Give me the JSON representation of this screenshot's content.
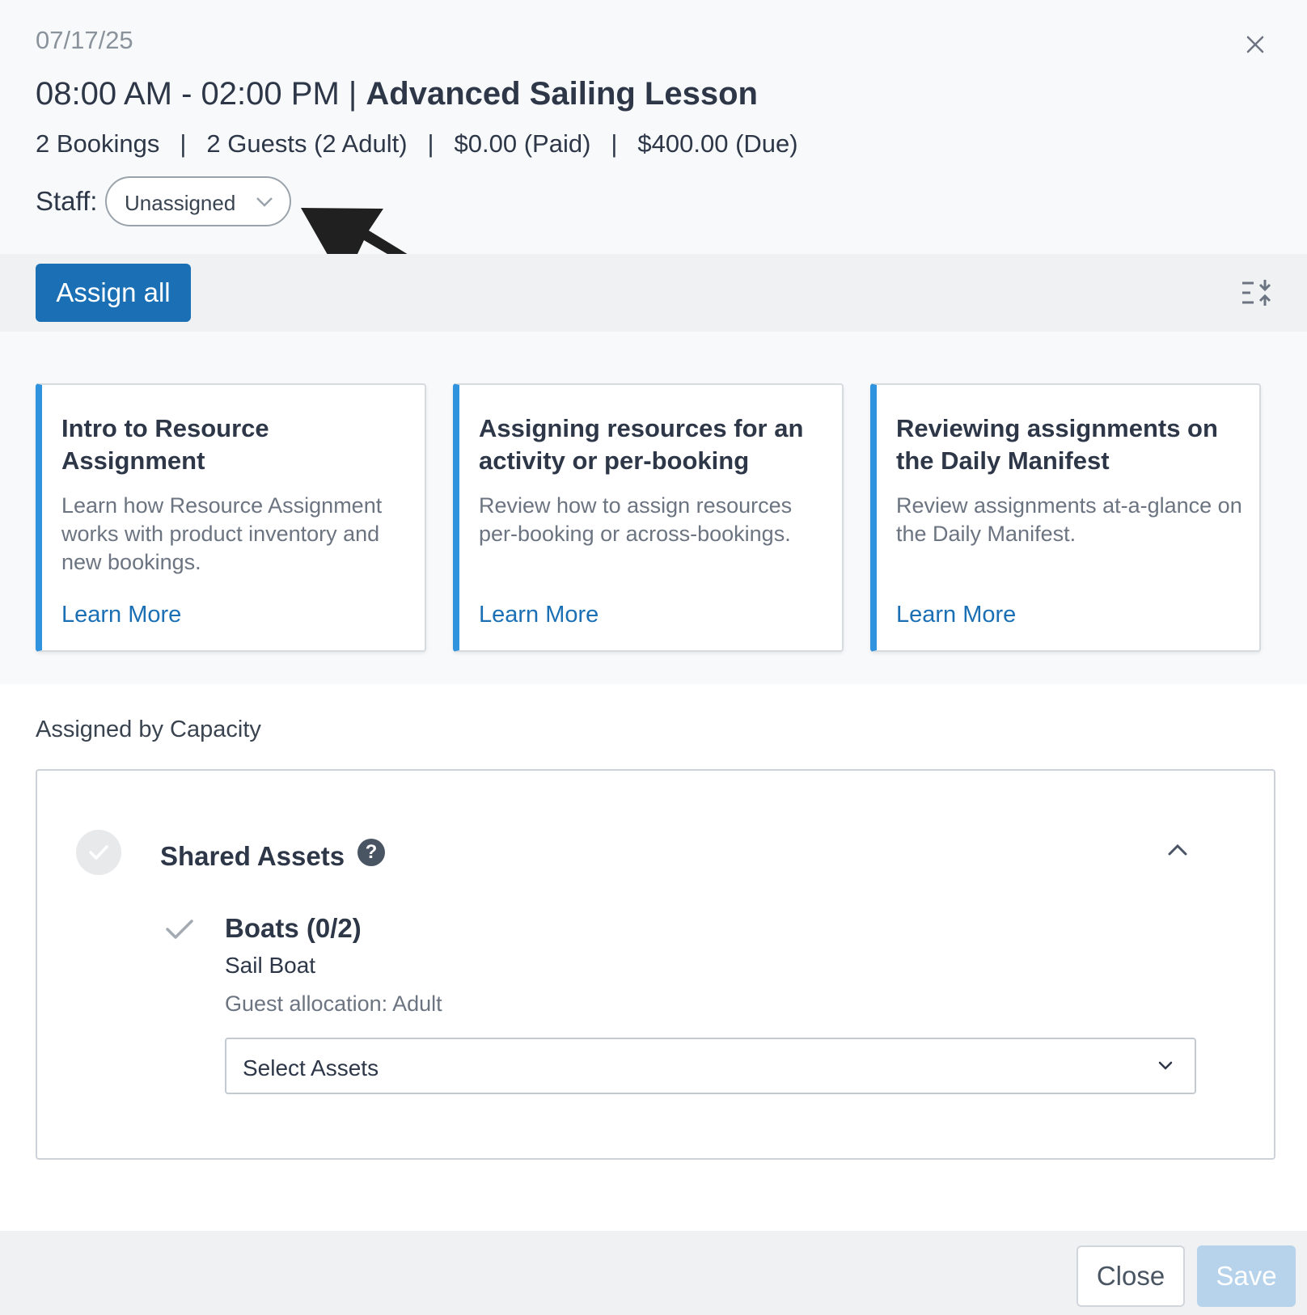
{
  "header": {
    "date": "07/17/25",
    "time_range": "08:00 AM - 02:00 PM |",
    "activity_name": "Advanced Sailing Lesson",
    "summary": {
      "bookings": "2 Bookings",
      "guests": "2 Guests (2 Adult)",
      "paid": "$0.00 (Paid)",
      "due": "$400.00 (Due)",
      "separator": "|"
    },
    "staff_label": "Staff:",
    "staff_value": "Unassigned",
    "close_icon": "close-icon"
  },
  "toolbar": {
    "assign_all_label": "Assign all",
    "collapse_icon": "collapse-all-icon"
  },
  "cards": [
    {
      "title": "Intro to Resource Assignment",
      "description": "Learn how Resource Assignment works with product inventory and new bookings.",
      "link": "Learn More"
    },
    {
      "title": "Assigning resources for an activity or per-booking",
      "description": "Review how to assign resources per-booking or across-bookings.",
      "link": "Learn More"
    },
    {
      "title": "Reviewing assignments on the Daily Manifest",
      "description": "Review assignments at-a-glance on the Daily Manifest.",
      "link": "Learn More"
    }
  ],
  "capacity": {
    "section_label": "Assigned by Capacity",
    "group_title": "Shared Assets",
    "help_icon": "?",
    "resource": {
      "title": "Boats (0/2)",
      "type": "Sail Boat",
      "allocation": "Guest allocation: Adult",
      "select_placeholder": "Select Assets"
    }
  },
  "footer": {
    "close_label": "Close",
    "save_label": "Save"
  },
  "colors": {
    "primary": "#1a6fb5",
    "card_accent": "#2f94dd",
    "save_disabled": "#b7d3ec"
  }
}
